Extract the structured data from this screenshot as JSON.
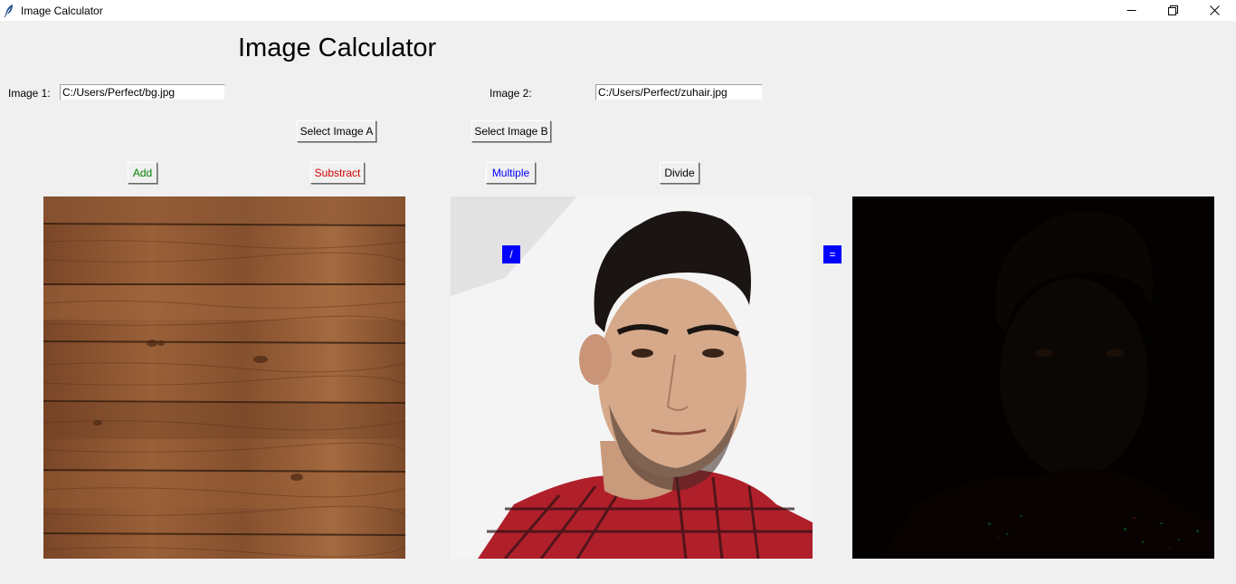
{
  "window": {
    "title": "Image Calculator",
    "controls": [
      "minimize-icon",
      "restore-icon",
      "close-icon"
    ]
  },
  "heading": "Image Calculator",
  "image1": {
    "label": "Image 1:",
    "path": "C:/Users/Perfect/bg.jpg"
  },
  "image2": {
    "label": "Image 2:",
    "path": "C:/Users/Perfect/zuhair.jpg"
  },
  "select_buttons": {
    "a": "Select Image A",
    "b": "Select Image B"
  },
  "operations": {
    "add": {
      "label": "Add",
      "color": "#008000"
    },
    "subtract": {
      "label": "Substract",
      "color": "#d00000"
    },
    "multiply": {
      "label": "Multiple",
      "color": "#0000ff"
    },
    "divide": {
      "label": "Divide",
      "color": "#000000"
    }
  },
  "operator_symbol": "/",
  "equals_symbol": "=",
  "colors": {
    "operator_bg": "#0000ff",
    "window_bg": "#f0f0f0"
  }
}
